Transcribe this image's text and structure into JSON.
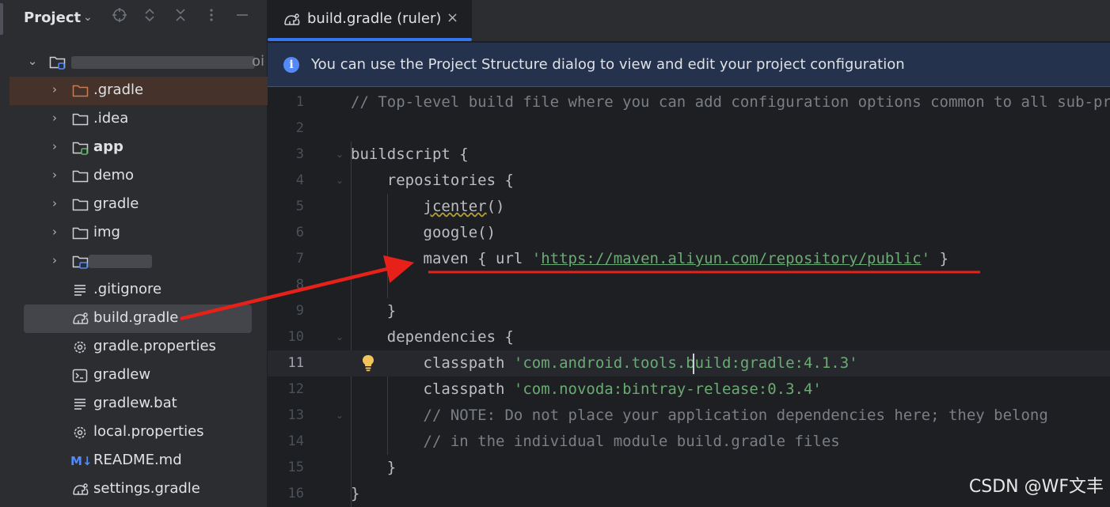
{
  "project_panel": {
    "title": "Project",
    "header_icons": [
      "crosshair-icon",
      "expand-icon",
      "collapse-icon",
      "more-icon",
      "minimize-icon"
    ],
    "root": {
      "label_redacted": true,
      "suffix": "oi"
    },
    "tree": [
      {
        "label": ".gradle",
        "type": "folder",
        "expandable": true,
        "selected_dir": true
      },
      {
        "label": ".idea",
        "type": "folder",
        "expandable": true
      },
      {
        "label": "app",
        "type": "module",
        "expandable": true,
        "bold": true
      },
      {
        "label": "demo",
        "type": "folder",
        "expandable": true
      },
      {
        "label": "gradle",
        "type": "folder",
        "expandable": true
      },
      {
        "label": "img",
        "type": "folder",
        "expandable": true
      },
      {
        "label": "",
        "type": "module",
        "expandable": true,
        "redacted": true
      },
      {
        "label": ".gitignore",
        "type": "text-file"
      },
      {
        "label": "build.gradle",
        "type": "gradle-file",
        "selected": true
      },
      {
        "label": "gradle.properties",
        "type": "settings-file"
      },
      {
        "label": "gradlew",
        "type": "terminal-file"
      },
      {
        "label": "gradlew.bat",
        "type": "text-file"
      },
      {
        "label": "local.properties",
        "type": "settings-file"
      },
      {
        "label": "README.md",
        "type": "markdown-file"
      },
      {
        "label": "settings.gradle",
        "type": "gradle-file"
      }
    ]
  },
  "editor": {
    "tab": {
      "label": "build.gradle (ruler)",
      "close": "×"
    },
    "banner": "You can use the Project Structure dialog to view and edit your project configuration",
    "current_line": 11,
    "lines": [
      {
        "n": "1",
        "text": "// Top-level build file where you can add configuration options common to all sub-projects/modules."
      },
      {
        "n": "2",
        "text": ""
      },
      {
        "n": "3",
        "text": "buildscript {"
      },
      {
        "n": "4",
        "text": "    repositories {"
      },
      {
        "n": "5",
        "text": "        jcenter()"
      },
      {
        "n": "6",
        "text": "        google()"
      },
      {
        "n": "7",
        "text": "        maven { url 'https://maven.aliyun.com/repository/public' }"
      },
      {
        "n": "8",
        "text": ""
      },
      {
        "n": "9",
        "text": "    }"
      },
      {
        "n": "10",
        "text": "    dependencies {"
      },
      {
        "n": "11",
        "text": "        classpath 'com.android.tools.build:gradle:4.1.3'"
      },
      {
        "n": "12",
        "text": "        classpath 'com.novoda:bintray-release:0.3.4'"
      },
      {
        "n": "13",
        "text": "        // NOTE: Do not place your application dependencies here; they belong"
      },
      {
        "n": "14",
        "text": "        // in the individual module build.gradle files"
      },
      {
        "n": "15",
        "text": "    }"
      },
      {
        "n": "16",
        "text": "}"
      }
    ],
    "tokens": {
      "l1": "// Top-level build file where you can add configuration options common to all sub-projects/modules.",
      "l3": "buildscript {",
      "l4": "    repositories {",
      "l5_fn": "jcenter",
      "l5_rest": "()",
      "l6": "        google()",
      "l7_a": "        maven { url ",
      "l7_q1": "'",
      "l7_url": "https://maven.aliyun.com/repository/public",
      "l7_q2": "'",
      "l7_b": " }",
      "l9": "    }",
      "l10": "    dependencies {",
      "l11_a": "        classpath ",
      "l11_str": "'com.android.tools.build:gradle:4.1.3'",
      "l12_a": "        classpath ",
      "l12_str": "'com.novoda:bintray-release:0.3.4'",
      "l13": "        // NOTE: Do not place your application dependencies here; they belong",
      "l14": "        // in the individual module build.gradle files",
      "l15": "    }",
      "l16": "}"
    }
  },
  "watermark": "CSDN @WF文丰",
  "annotation_color": "#e8201a"
}
